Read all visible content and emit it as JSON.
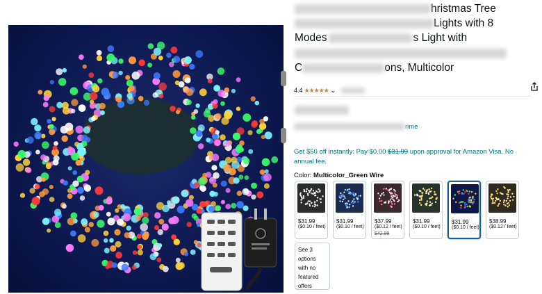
{
  "product": {
    "title_lines": [
      {
        "visible": "hristmas Tree"
      },
      {
        "visible": "Lights with 8"
      },
      {
        "visible_prefix": "Modes",
        "visible_suffix": "s Light with"
      },
      {
        "visible": ""
      },
      {
        "visible_prefix": "C",
        "visible_suffix": "ons, Multicolor"
      }
    ],
    "rating": "4.4",
    "stars_glyph": "★★★★★",
    "prime_suffix": "rime",
    "promo_prefix": "Get $50 off instantly: Pay $0.00 ",
    "promo_strike": "$31.99",
    "promo_suffix": " upon approval for Amazon Visa. No annual fee.",
    "color_label": "Color: ",
    "color_value": "Multicolor_Green Wire"
  },
  "swatches": [
    {
      "price": "$31.99",
      "unit": "($0.10 / feet)",
      "was": "",
      "palette": [
        "#ffffff",
        "#e8e8e8",
        "#f5f5f5"
      ],
      "bg": "#2b2b2b"
    },
    {
      "price": "$31.99",
      "unit": "($0.10 / feet)",
      "was": "",
      "palette": [
        "#9ad0ff",
        "#3f8cff",
        "#c9e7ff"
      ],
      "bg": "#1b2a4e"
    },
    {
      "price": "$37.99",
      "unit": "($0.12 / feet)",
      "was": "$42.99",
      "palette": [
        "#ff6aa0",
        "#ffd2e2",
        "#ffffff"
      ],
      "bg": "#3a2a2e"
    },
    {
      "price": "$31.99",
      "unit": "($0.10 / feet)",
      "was": "",
      "palette": [
        "#fff2a8",
        "#ffd966",
        "#fffbe0"
      ],
      "bg": "#26322a"
    },
    {
      "price": "$31.99",
      "unit": "($0.10 / feet)",
      "was": "",
      "palette": [
        "#ff3b3b",
        "#3bff6a",
        "#3b7bff",
        "#ffd23b"
      ],
      "bg": "#0e1846"
    },
    {
      "price": "$38.99",
      "unit": "($0.12 / feet)",
      "was": "",
      "palette": [
        "#ffdf8a",
        "#fff3c4",
        "#ffc94d"
      ],
      "bg": "#2f2a1e"
    }
  ],
  "see_options": "See 3 options with no featured offers",
  "colors": {
    "link": "#007185",
    "star": "#de7921",
    "selected_border": "#1f5d8a"
  },
  "icons": {
    "share": "share-icon",
    "chevron": "chevron-down-icon",
    "remote": "remote-control-icon",
    "adapter": "power-adapter-icon"
  }
}
